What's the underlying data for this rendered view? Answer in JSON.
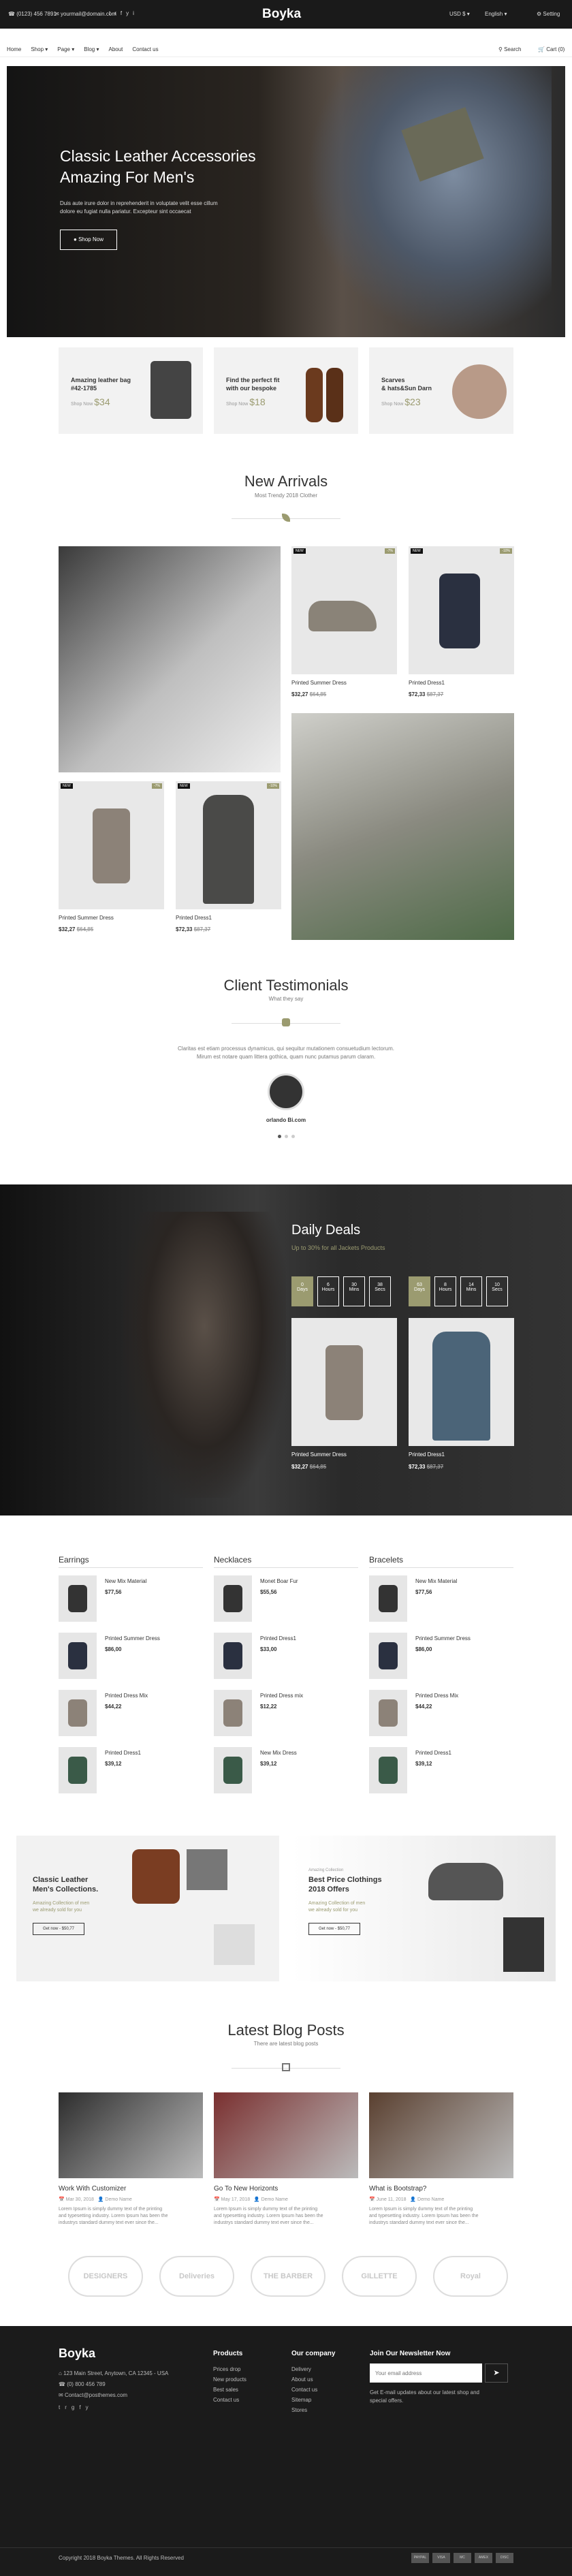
{
  "topbar": {
    "phone": "(0123) 456 7891",
    "email": "yourmail@domain.com",
    "logo": "Boyka",
    "currency": "USD $",
    "language": "English",
    "setting": "Setting"
  },
  "nav": {
    "items": [
      "Home",
      "Shop",
      "Page",
      "Blog",
      "About",
      "Contact us"
    ],
    "search": "Search",
    "cart": "Cart (0)"
  },
  "hero": {
    "title1": "Classic Leather Accessories",
    "title2": "Amazing For Men's",
    "desc1": "Duis aute irure dolor in reprehenderit in voluptate velit esse cillum",
    "desc2": "dolore eu fugiat nulla pariatur. Excepteur sint occaecat",
    "button": "Shop Now"
  },
  "promos": [
    {
      "t1": "Amazing leather bag",
      "t2": "#42-1785",
      "label": "Shop Now",
      "price": "$34"
    },
    {
      "t1": "Find the perfect fit",
      "t2": "with our bespoke",
      "label": "Shop Now",
      "price": "$18"
    },
    {
      "t1": "Scarves",
      "t2": "& hats&Sun Darn",
      "label": "Shop Now",
      "price": "$23"
    }
  ],
  "arrivals": {
    "title": "New Arrivals",
    "sub": "Most Trendy 2018 Clother",
    "products": [
      {
        "name": "Printed Summer Dress",
        "price": "$32,27",
        "old": "$64,85",
        "badge": "NEW",
        "disc": "-7%"
      },
      {
        "name": "Printed Dress1",
        "price": "$72,33",
        "old": "$87,37",
        "badge": "NEW",
        "disc": "-10%"
      },
      {
        "name": "Printed Summer Dress",
        "price": "$32,27",
        "old": "$64,85",
        "badge": "NEW",
        "disc": "-7%"
      },
      {
        "name": "Printed Dress1",
        "price": "$72,33",
        "old": "$87,37",
        "badge": "NEW",
        "disc": "-10%"
      }
    ]
  },
  "testimonials": {
    "title": "Client Testimonials",
    "sub": "What they say",
    "quote1": "Claritas est etiam processus dynamicus, qui sequitur mutationem consuetudium lectorum.",
    "quote2": "Mirum est notare quam littera gothica, quam nunc putamus parum claram.",
    "author": "orlando Bi.com"
  },
  "deals": {
    "title": "Daily Deals",
    "sub": "Up to 30% for all Jackets Products",
    "cd1": [
      {
        "v": "0",
        "l": "Days"
      },
      {
        "v": "6",
        "l": "Hours"
      },
      {
        "v": "30",
        "l": "Mins"
      },
      {
        "v": "38",
        "l": "Secs"
      }
    ],
    "cd2": [
      {
        "v": "63",
        "l": "Days"
      },
      {
        "v": "8",
        "l": "Hours"
      },
      {
        "v": "14",
        "l": "Mins"
      },
      {
        "v": "10",
        "l": "Secs"
      }
    ],
    "products": [
      {
        "name": "Printed Summer Dress",
        "price": "$32,27",
        "old": "$64,85"
      },
      {
        "name": "Printed Dress1",
        "price": "$72,33",
        "old": "$87,37"
      }
    ]
  },
  "lists": [
    {
      "title": "Earrings",
      "items": [
        {
          "n": "New Mix Material",
          "p": "$77,56"
        },
        {
          "n": "Printed Summer Dress",
          "p": "$86,00"
        },
        {
          "n": "Printed Dress Mix",
          "p": "$44,22"
        },
        {
          "n": "Printed Dress1",
          "p": "$39,12"
        }
      ]
    },
    {
      "title": "Necklaces",
      "items": [
        {
          "n": "Monet Boar Fur",
          "p": "$55,56"
        },
        {
          "n": "Printed Dress1",
          "p": "$33,00"
        },
        {
          "n": "Printed Dress mix",
          "p": "$12,22"
        },
        {
          "n": "New Mix Dress",
          "p": "$39,12"
        }
      ]
    },
    {
      "title": "Bracelets",
      "items": [
        {
          "n": "New Mix Material",
          "p": "$77,56"
        },
        {
          "n": "Printed Summer Dress",
          "p": "$86,00"
        },
        {
          "n": "Printed Dress Mix",
          "p": "$44,22"
        },
        {
          "n": "Printed Dress1",
          "p": "$39,12"
        }
      ]
    }
  ],
  "banners": [
    {
      "small": "",
      "t1": "Classic Leather",
      "t2": "Men's Collections.",
      "d1": "Amazing Collection of men",
      "d2": "we already sold for you",
      "btn": "Get now - $50,77"
    },
    {
      "small": "Amazing Collection",
      "t1": "Best Price Clothings",
      "t2": "2018 Offers",
      "d1": "Amazing Collection of men",
      "d2": "we already sold for you",
      "btn": "Get now - $50,77"
    }
  ],
  "blog": {
    "title": "Latest Blog Posts",
    "sub": "There are latest blog posts",
    "posts": [
      {
        "t": "Work With Customizer",
        "date": "Mar 30, 2018",
        "author": "Demo Name"
      },
      {
        "t": "Go To New Horizonts",
        "date": "May 17, 2018",
        "author": "Demo Name"
      },
      {
        "t": "What is Bootstrap?",
        "date": "June 11, 2018",
        "author": "Demo Name"
      }
    ],
    "excerpt1": "Lorem Ipsum is simply dummy text of the printing",
    "excerpt2": "and typesetting industry. Lorem Ipsum has been the",
    "excerpt3": "industrys standard dummy text ever since the..."
  },
  "brands": [
    "DESIGNERS",
    "Deliveries",
    "THE BARBER",
    "GILLETTE",
    "Royal"
  ],
  "footer": {
    "logo": "Boyka",
    "address": "123 Main Street, Anytown, CA 12345 - USA",
    "phone": "(0) 800 456 789",
    "email": "Contact@posthemes.com",
    "products_title": "Products",
    "products": [
      "Prices drop",
      "New products",
      "Best sales",
      "Contact us"
    ],
    "company_title": "Our company",
    "company": [
      "Delivery",
      "About us",
      "Contact us",
      "Sitemap",
      "Stores"
    ],
    "news_title": "Join Our Newsletter Now",
    "news_placeholder": "Your email address",
    "news_desc1": "Get E-mail updates about our latest shop and",
    "news_desc2": "special offers.",
    "copyright": "Copyright 2018 Boyka Themes. All Rights Reserved",
    "payments": [
      "PAYPAL",
      "VISA",
      "MC",
      "AMEX",
      "DISC"
    ]
  }
}
